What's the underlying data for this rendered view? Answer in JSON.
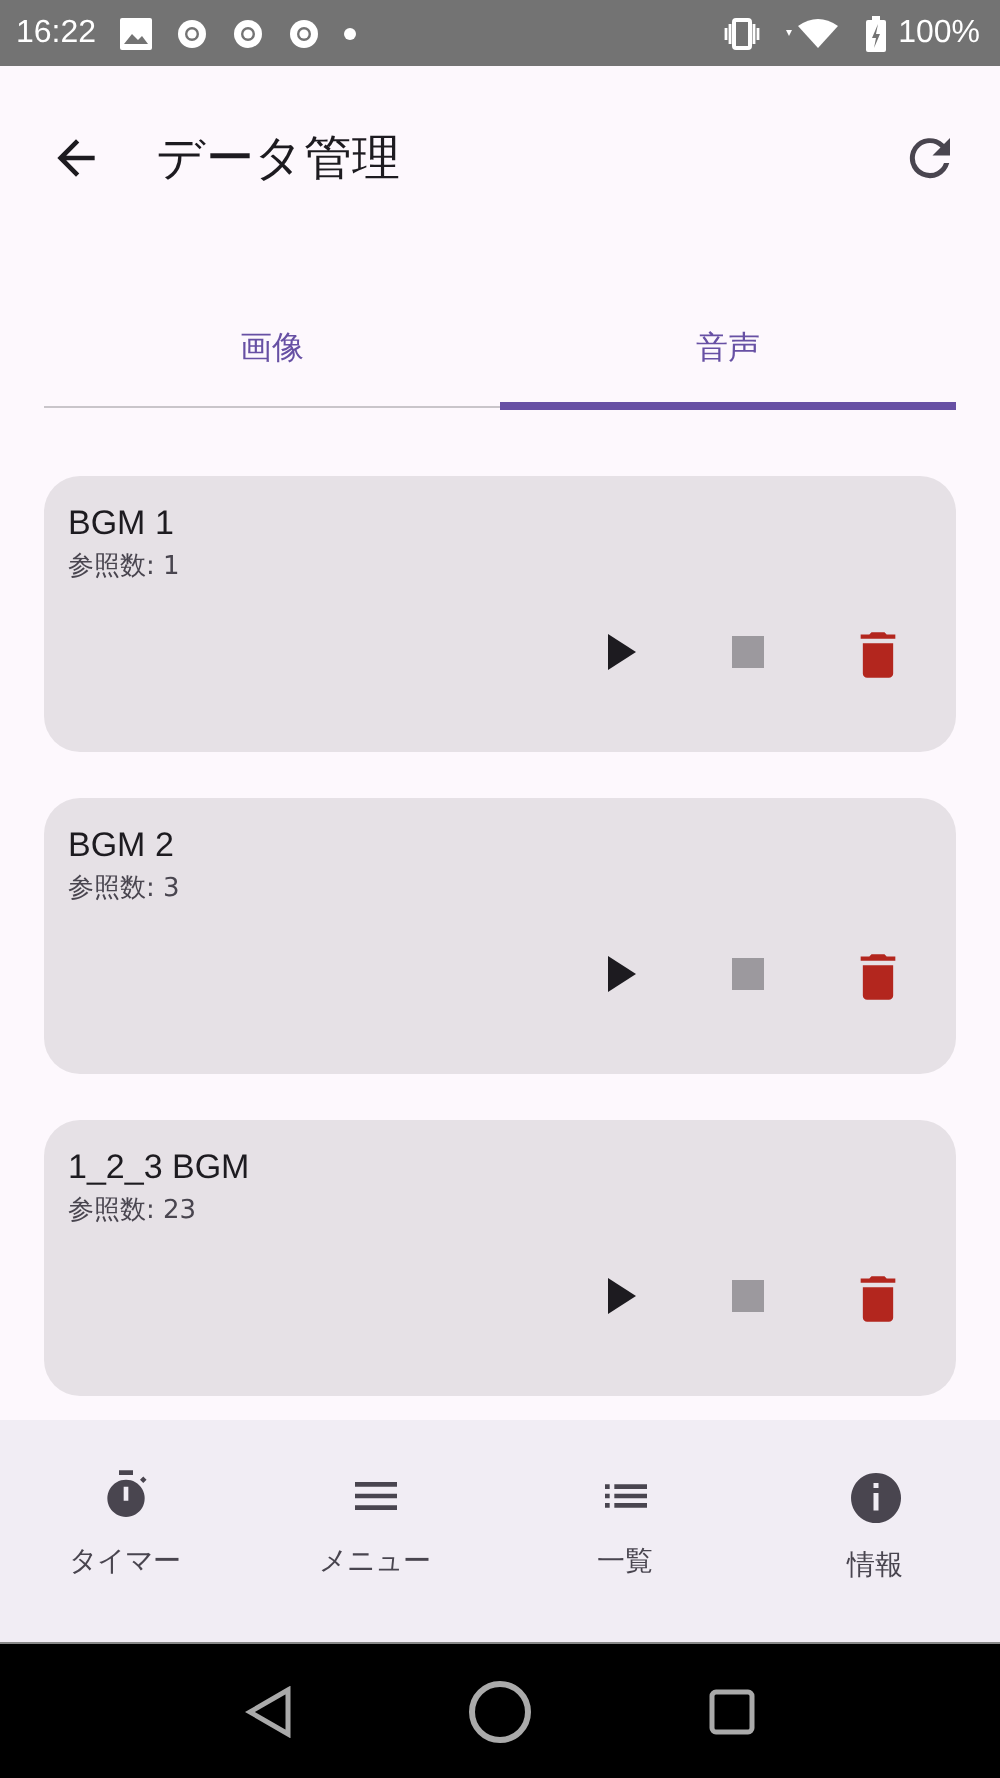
{
  "status_bar": {
    "time": "16:22",
    "battery": "100%"
  },
  "app_bar": {
    "title": "データ管理"
  },
  "tabs": [
    {
      "label": "画像",
      "selected": false
    },
    {
      "label": "音声",
      "selected": true
    }
  ],
  "items": [
    {
      "name": "BGM 1",
      "refs": "参照数: 1",
      "playing": false
    },
    {
      "name": "BGM 2",
      "refs": "参照数: 3",
      "playing": false
    },
    {
      "name": "1_2_3 BGM",
      "refs": "参照数: 23",
      "playing": false
    }
  ],
  "bottom_nav": [
    {
      "kind": "timer",
      "label": "タイマー"
    },
    {
      "kind": "menu",
      "label": "メニュー"
    },
    {
      "kind": "list",
      "label": "一覧"
    },
    {
      "kind": "info",
      "label": "情報"
    }
  ]
}
